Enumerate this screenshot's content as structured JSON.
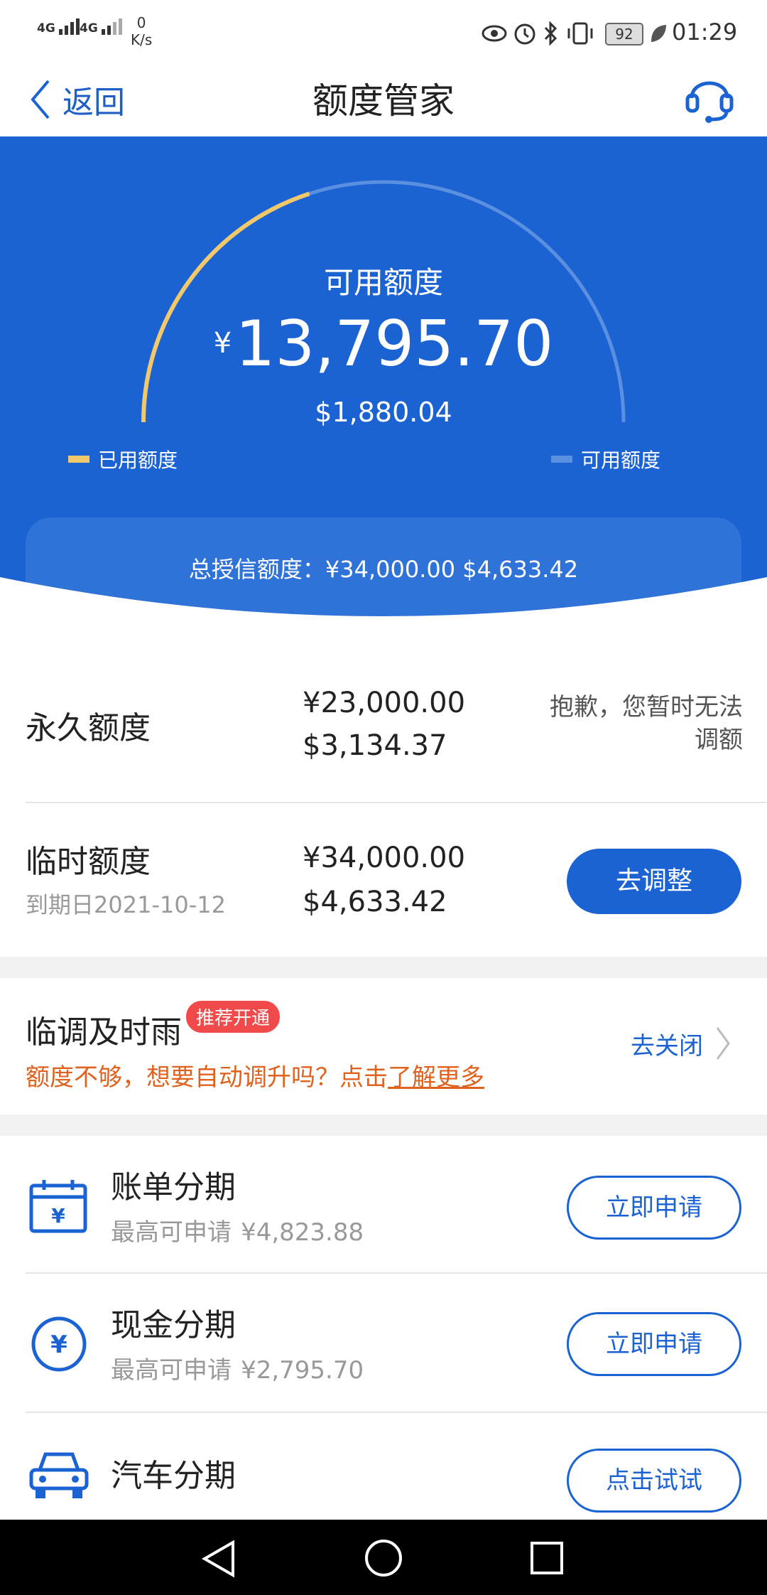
{
  "status_bar": {
    "net1": "4G",
    "net2": "4G",
    "speed_value": "0",
    "speed_unit": "K/s",
    "battery": "92",
    "time": "01:29",
    "icons": [
      "eye-icon",
      "alarm-icon",
      "bluetooth-icon",
      "vibrate-icon",
      "battery-icon",
      "leaf-icon"
    ]
  },
  "header": {
    "back_label": "返回",
    "title": "额度管家",
    "support_icon": "headset-icon"
  },
  "hero": {
    "available_label": "可用额度",
    "currency_symbol": "¥",
    "available_cny": "13,795.70",
    "available_usd": "$1,880.04",
    "legend_used": "已用额度",
    "legend_available": "可用额度",
    "used_fraction": 0.4,
    "colors": {
      "background": "#1b63d3",
      "used": "#f1c86a",
      "available": "#5b8fe0"
    },
    "total_label": "总授信额度：¥34,000.00  $4,633.42"
  },
  "limits": [
    {
      "label": "永久额度",
      "cny": "¥23,000.00",
      "usd": "$3,134.37",
      "note": "抱歉，您暂时无法调额"
    },
    {
      "label": "临时额度",
      "expiry": "到期日2021-10-12",
      "cny": "¥34,000.00",
      "usd": "$4,633.42",
      "button": "去调整"
    }
  ],
  "promo": {
    "title": "临调及时雨",
    "badge": "推荐开通",
    "desc": "额度不够，想要自动调升吗？点击",
    "link": "了解更多",
    "action": "去关闭"
  },
  "installments": [
    {
      "icon": "calendar-yuan-icon",
      "title": "账单分期",
      "sub_label": "最高可申请",
      "sub_value": "¥4,823.88",
      "button": "立即申请"
    },
    {
      "icon": "yuan-coin-icon",
      "title": "现金分期",
      "sub_label": "最高可申请",
      "sub_value": "¥2,795.70",
      "button": "立即申请"
    },
    {
      "icon": "car-icon",
      "title": "汽车分期",
      "button": "点击试试"
    }
  ],
  "nav": [
    "back-nav-icon",
    "home-nav-icon",
    "recents-nav-icon"
  ]
}
